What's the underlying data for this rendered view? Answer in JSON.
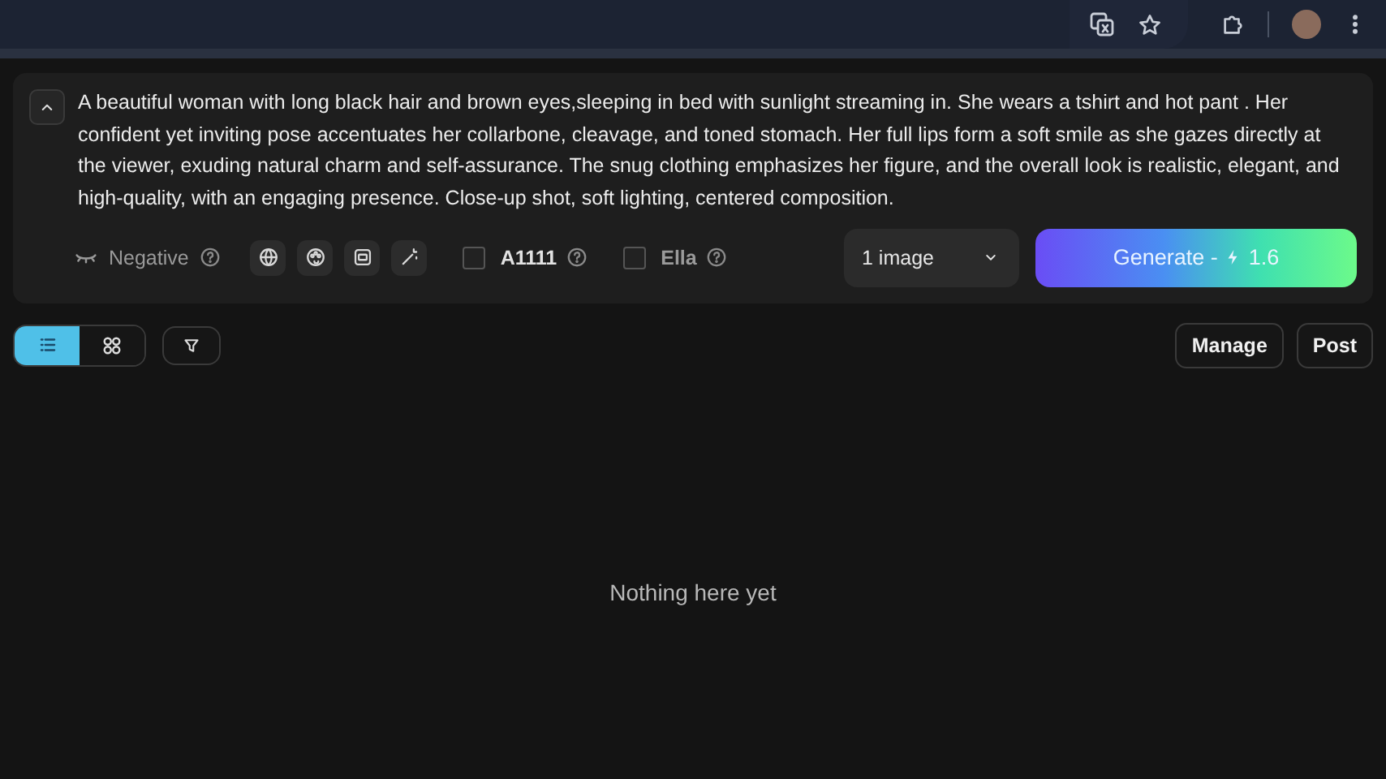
{
  "prompt": {
    "text": "A beautiful woman with long black hair and brown eyes,sleeping in bed with sunlight streaming in. She wears a tshirt and hot pant . Her confident yet inviting pose accentuates her collarbone, cleavage, and toned stomach. Her full lips form a soft smile as she gazes directly at the viewer, exuding natural charm and self-assurance. The snug clothing emphasizes her figure, and the overall look is realistic, elegant, and high-quality, with an engaging presence. Close-up shot, soft lighting, centered composition."
  },
  "negative": {
    "label": "Negative"
  },
  "options": [
    {
      "label": "A1111",
      "checked": false
    },
    {
      "label": "Ella",
      "checked": false
    }
  ],
  "image_count": {
    "value": "1 image"
  },
  "generate": {
    "label": "Generate -",
    "cost": "1.6"
  },
  "views": [
    {
      "kind": "list",
      "selected": true
    },
    {
      "kind": "grid",
      "selected": false
    }
  ],
  "actions": [
    "Manage",
    "Post"
  ],
  "empty_message": "Nothing here yet"
}
